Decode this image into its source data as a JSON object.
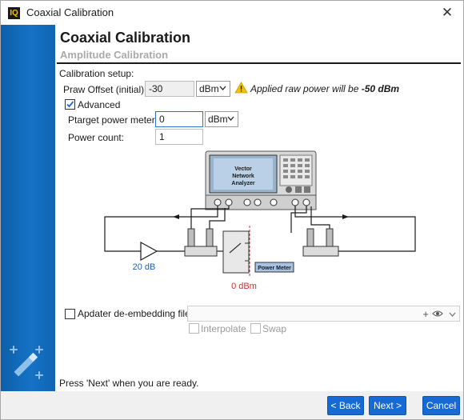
{
  "window": {
    "title": "Coaxial Calibration",
    "app_icon_text": "IQ",
    "close_glyph": "✕"
  },
  "header": {
    "title": "Coaxial Calibration",
    "subtitle": "Amplitude Calibration"
  },
  "setup": {
    "section_label": "Calibration setup:",
    "praw_label": "Praw Offset (initial):",
    "praw_value": "-30",
    "praw_unit": "dBm",
    "warning_prefix": "Applied raw power will be ",
    "warning_value": "-50 dBm",
    "advanced_label": "Advanced",
    "advanced_checked": true,
    "ptarget_label": "Ptarget power meter:",
    "ptarget_value": "0",
    "ptarget_unit": "dBm",
    "power_count_label": "Power count:",
    "power_count_value": "1"
  },
  "diagram": {
    "vna_label_1": "Vector",
    "vna_label_2": "Network",
    "vna_label_3": "Analyzer",
    "amp_gain": "20 dB",
    "power_meter_label": "Power Meter",
    "ref_level": "0 dBm"
  },
  "embedding": {
    "label": "Apdater de-embedding file:",
    "checked": false,
    "file_value": "",
    "interpolate_label": "Interpolate",
    "swap_label": "Swap"
  },
  "footer": {
    "hint": "Press 'Next' when you are ready.",
    "back_label": "< Back",
    "next_label": "Next >",
    "cancel_label": "Cancel"
  },
  "colors": {
    "accent": "#1769d3",
    "sidebar": "#1672c6",
    "warning": "#f2c300",
    "diagram_label": "#1f5fa8",
    "ref_label": "#d23030"
  }
}
